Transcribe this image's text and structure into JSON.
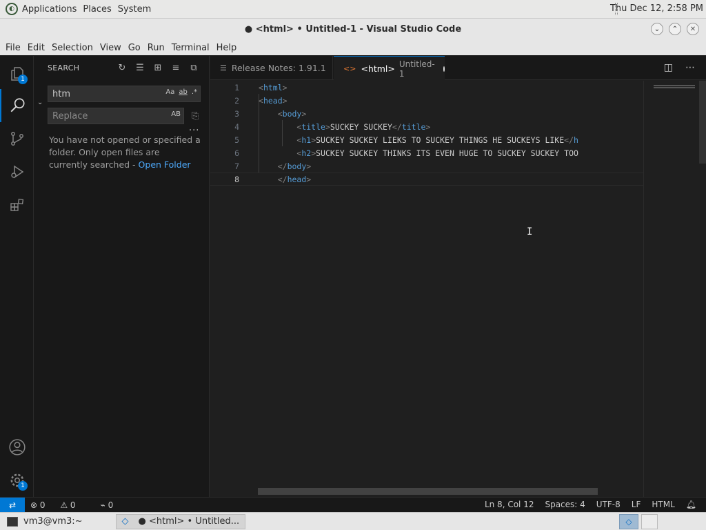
{
  "gnome": {
    "menus": [
      "Applications",
      "Places",
      "System"
    ],
    "clock": "Thu Dec 12,  2:58 PM"
  },
  "window": {
    "title": "● <html> • Untitled-1 - Visual Studio Code"
  },
  "menubar": [
    "File",
    "Edit",
    "Selection",
    "View",
    "Go",
    "Run",
    "Terminal",
    "Help"
  ],
  "activity": {
    "explorer_badge": "1",
    "settings_badge": "1"
  },
  "search": {
    "title": "SEARCH",
    "query": "htm",
    "replace_placeholder": "Replace",
    "opt_case": "Aa",
    "opt_word": "ab",
    "opt_regex": ".*",
    "opt_preserve_case": "AB",
    "more": "...",
    "message": "You have not opened or specified a folder. Only open files are currently searched - ",
    "open_folder_link": "Open Folder"
  },
  "tabs": [
    {
      "label": "Release Notes: 1.91.1"
    },
    {
      "label": "<html>",
      "sub": "Untitled-1"
    }
  ],
  "code": {
    "lines": [
      {
        "n": "1",
        "parts": [
          [
            "brk",
            "<"
          ],
          [
            "tag",
            "html"
          ],
          [
            "brk",
            ">"
          ]
        ]
      },
      {
        "n": "2",
        "parts": [
          [
            "brk",
            "<"
          ],
          [
            "tag",
            "head"
          ],
          [
            "brk",
            ">"
          ]
        ]
      },
      {
        "n": "3",
        "parts": [
          [
            "txt",
            "    "
          ],
          [
            "brk",
            "<"
          ],
          [
            "tag",
            "body"
          ],
          [
            "brk",
            ">"
          ]
        ]
      },
      {
        "n": "4",
        "parts": [
          [
            "txt",
            "        "
          ],
          [
            "brk",
            "<"
          ],
          [
            "tag",
            "title"
          ],
          [
            "brk",
            ">"
          ],
          [
            "txt",
            "SUCKEY SUCKEY"
          ],
          [
            "brk",
            "</"
          ],
          [
            "tag",
            "title"
          ],
          [
            "brk",
            ">"
          ]
        ]
      },
      {
        "n": "5",
        "parts": [
          [
            "txt",
            "        "
          ],
          [
            "brk",
            "<"
          ],
          [
            "tag",
            "h1"
          ],
          [
            "brk",
            ">"
          ],
          [
            "txt",
            "SUCKEY SUCKEY LIEKS TO SUCKEY THINGS HE SUCKEYS LIKE"
          ],
          [
            "brk",
            "</"
          ],
          [
            "tag",
            "h"
          ]
        ]
      },
      {
        "n": "6",
        "parts": [
          [
            "txt",
            "        "
          ],
          [
            "brk",
            "<"
          ],
          [
            "tag",
            "h2"
          ],
          [
            "brk",
            ">"
          ],
          [
            "txt",
            "SUCKEY SUCKEY THINKS ITS EVEN HUGE TO SUCKEY SUCKEY TOO"
          ]
        ]
      },
      {
        "n": "7",
        "parts": [
          [
            "txt",
            "    "
          ],
          [
            "brk",
            "</"
          ],
          [
            "tag",
            "body"
          ],
          [
            "brk",
            ">"
          ]
        ]
      },
      {
        "n": "8",
        "parts": [
          [
            "txt",
            "    "
          ],
          [
            "brk",
            "</"
          ],
          [
            "tag",
            "head"
          ],
          [
            "brk",
            ">"
          ]
        ]
      }
    ]
  },
  "status": {
    "errors": "0",
    "warnings": "0",
    "ports": "0",
    "position": "Ln 8, Col 12",
    "spaces": "Spaces: 4",
    "encoding": "UTF-8",
    "eol": "LF",
    "language": "HTML"
  },
  "taskbar": [
    {
      "label": "vm3@vm3:~"
    },
    {
      "label": "● <html> • Untitled..."
    }
  ]
}
